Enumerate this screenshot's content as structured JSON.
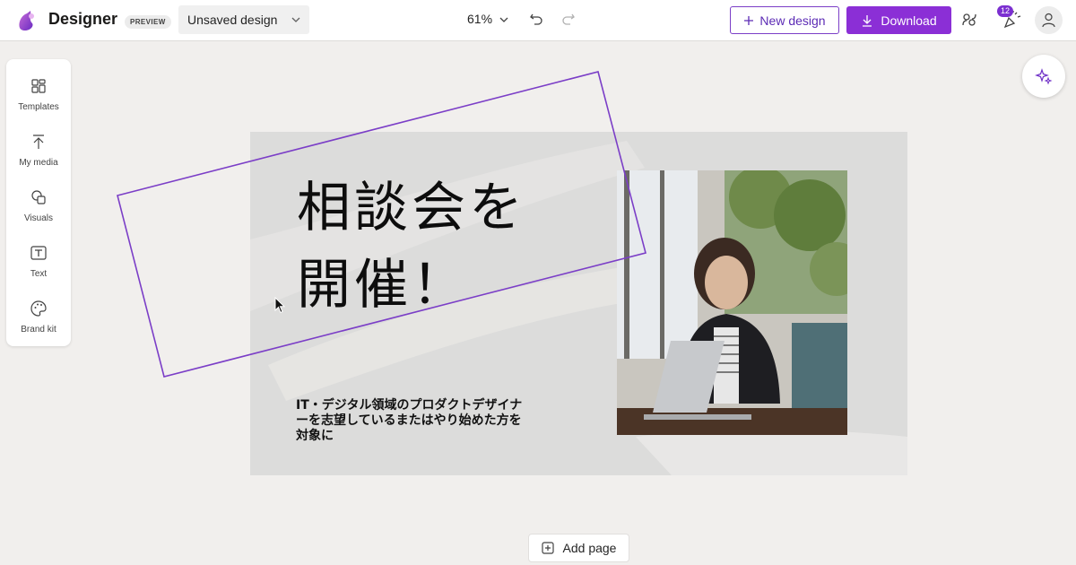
{
  "app": {
    "title": "Designer",
    "badge": "PREVIEW",
    "design_name": "Unsaved design"
  },
  "toolbar": {
    "zoom": "61%",
    "new_design_label": "New design",
    "download_label": "Download",
    "notification_count": "12"
  },
  "sidebar": {
    "items": [
      {
        "label": "Templates",
        "icon": "templates-icon"
      },
      {
        "label": "My media",
        "icon": "upload-icon"
      },
      {
        "label": "Visuals",
        "icon": "visuals-icon"
      },
      {
        "label": "Text",
        "icon": "text-icon"
      },
      {
        "label": "Brand kit",
        "icon": "palette-icon"
      }
    ]
  },
  "canvas": {
    "headline_line1": "相談会を",
    "headline_line2": "開催！",
    "subtext": "IT・デジタル領域のプロダクトデザイナーを志望しているまたはやり始めた方を対象に"
  },
  "footer": {
    "add_page_label": "Add page"
  },
  "colors": {
    "accent": "#8b2fd6",
    "selection": "#7b3ec7",
    "canvas_bg": "#f1efed"
  }
}
